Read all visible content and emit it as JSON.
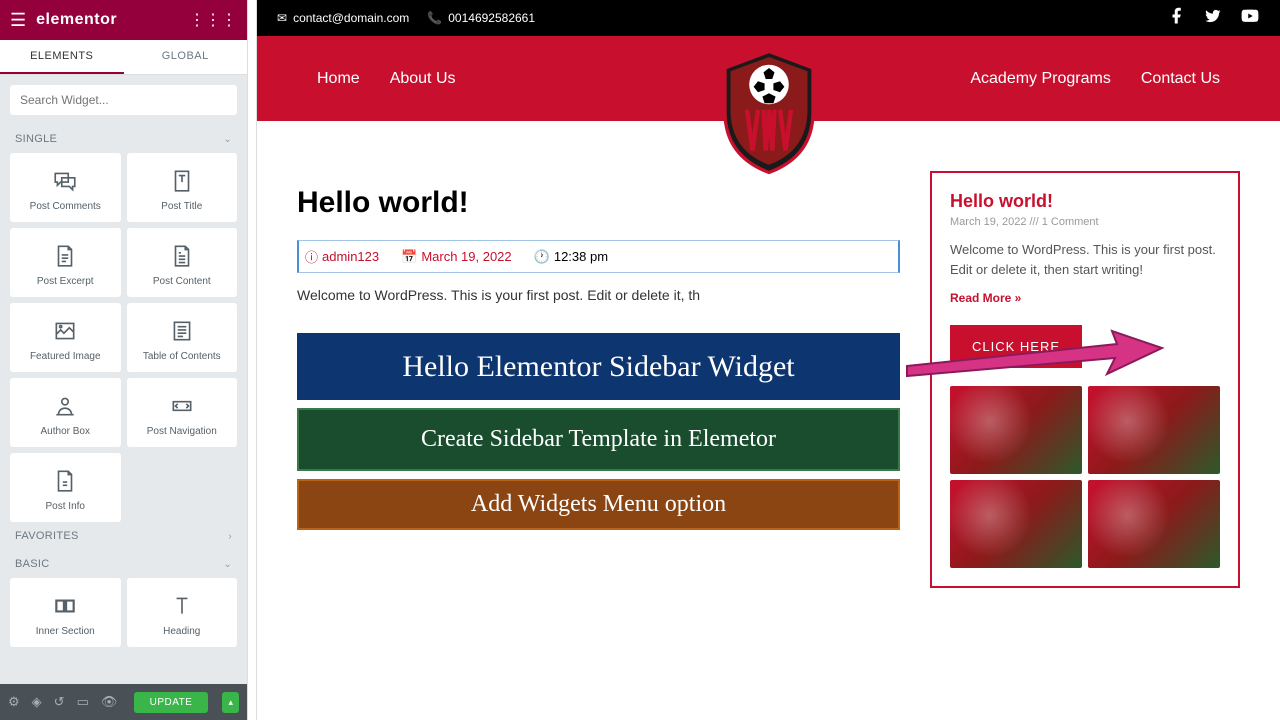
{
  "panel": {
    "logo": "elementor",
    "tabs": {
      "elements": "ELEMENTS",
      "global": "GLOBAL"
    },
    "search_placeholder": "Search Widget...",
    "sections": {
      "single": "SINGLE",
      "favorites": "FAVORITES",
      "basic": "BASIC"
    },
    "widgets_single": [
      "Post Comments",
      "Post Title",
      "Post Excerpt",
      "Post Content",
      "Featured Image",
      "Table of Contents",
      "Author Box",
      "Post Navigation",
      "Post Info"
    ],
    "widgets_basic": [
      "Inner Section",
      "Heading"
    ],
    "update_btn": "UPDATE"
  },
  "topbar": {
    "email": "contact@domain.com",
    "phone": "0014692582661"
  },
  "nav": {
    "left": [
      "Home",
      "About Us"
    ],
    "right": [
      "Academy Programs",
      "Contact Us"
    ]
  },
  "post": {
    "title": "Hello world!",
    "author": "admin123",
    "date": "March 19, 2022",
    "time": "12:38 pm",
    "body": "Welcome to WordPress. This is your first post. Edit or delete it, th"
  },
  "banners": {
    "b1": "Hello Elementor Sidebar Widget",
    "b2": "Create Sidebar Template in Elemetor",
    "b3": "Add Widgets Menu option"
  },
  "sidebar": {
    "title": "Hello world!",
    "meta": "March 19, 2022 /// 1 Comment",
    "text": "Welcome to WordPress. This is your first post. Edit or delete it, then start writing!",
    "readmore": "Read More »",
    "button": "CLICK HERE"
  }
}
